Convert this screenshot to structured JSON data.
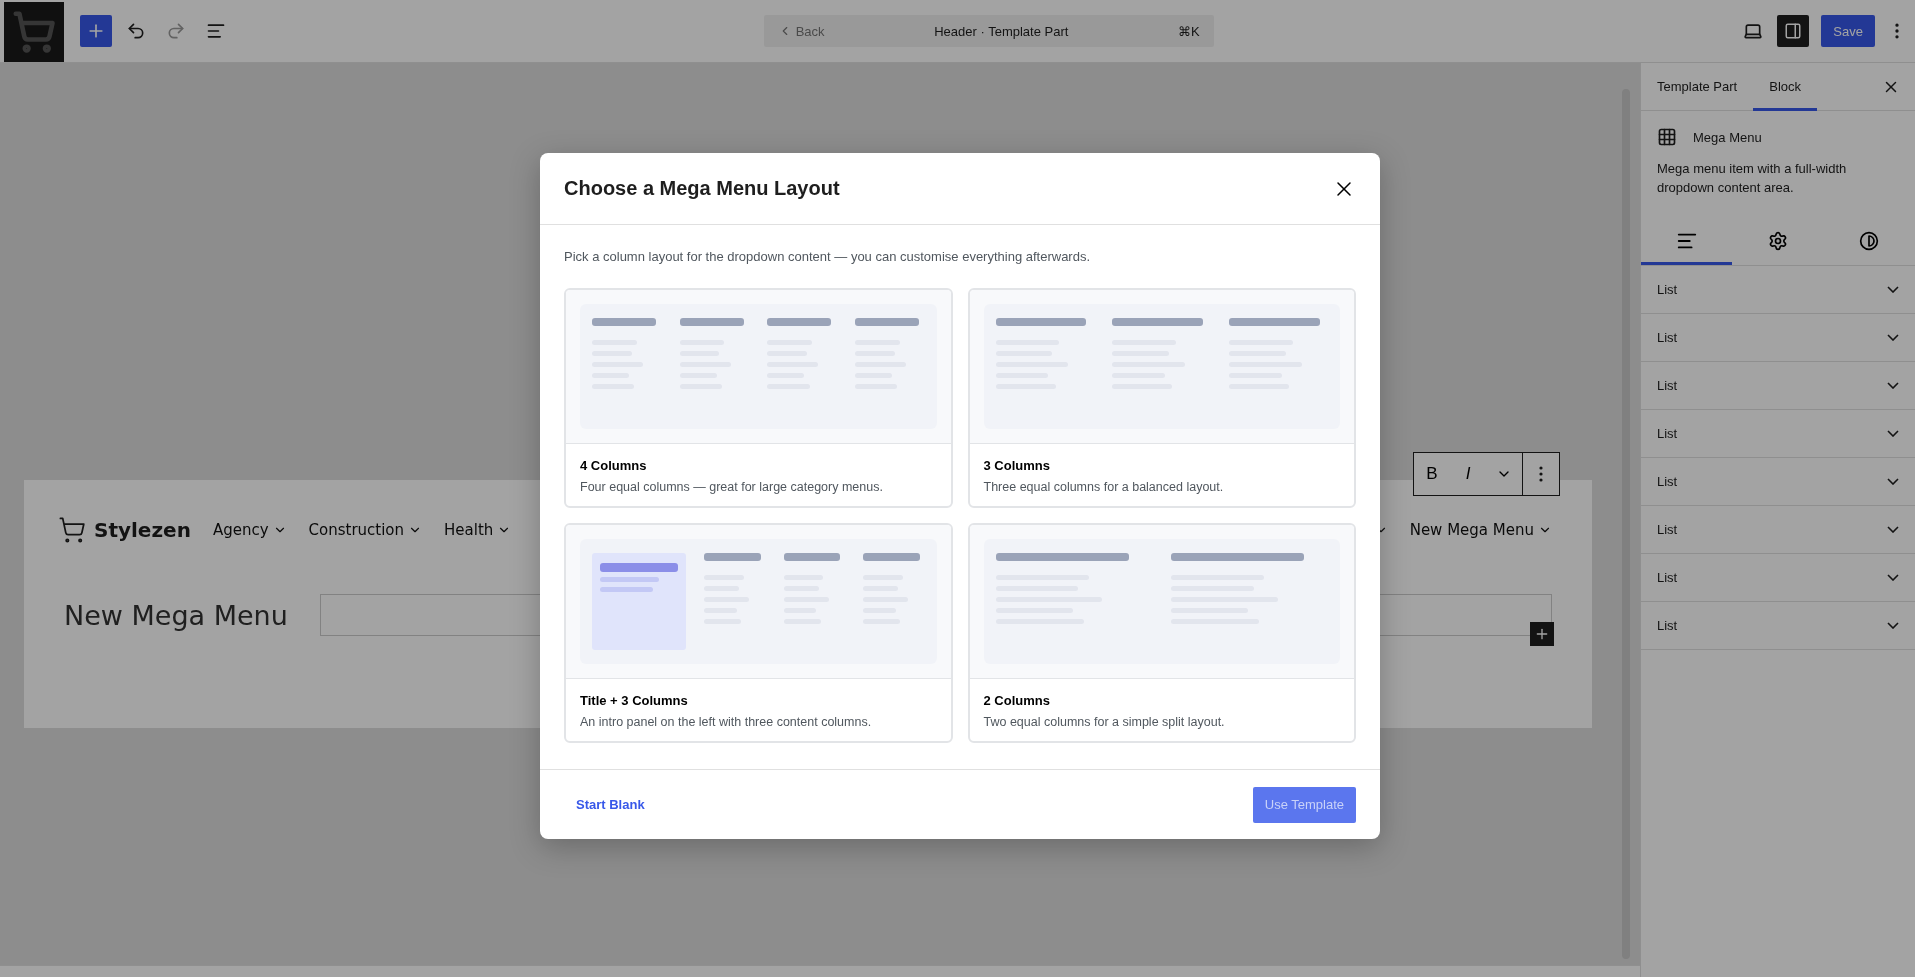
{
  "toolbar": {
    "back": "Back",
    "title": "Header · Template Part",
    "shortcut": "⌘K",
    "save": "Save"
  },
  "canvas": {
    "brand": "Stylezen",
    "nav_left": [
      {
        "label": "Agency"
      },
      {
        "label": "Construction"
      },
      {
        "label": "Health"
      }
    ],
    "nav_right": [
      {
        "label": "New Mega Menu"
      }
    ],
    "heading": "New Mega Menu",
    "format": {
      "bold": "B",
      "italic": "I"
    }
  },
  "sidebar": {
    "tabs": [
      {
        "label": "Template Part",
        "selected": false
      },
      {
        "label": "Block",
        "selected": true
      }
    ],
    "block": {
      "name": "Mega Menu",
      "description": "Mega menu item with a full-width dropdown content area."
    },
    "panel_tabs": [
      {
        "kind": "list",
        "selected": true
      },
      {
        "kind": "settings",
        "selected": false
      },
      {
        "kind": "styles",
        "selected": false
      }
    ],
    "sections": [
      {
        "label": "List",
        "expanded": false
      },
      {
        "label": "List",
        "expanded": false
      },
      {
        "label": "List",
        "expanded": false
      },
      {
        "label": "List",
        "expanded": false
      },
      {
        "label": "List",
        "expanded": false
      },
      {
        "label": "List",
        "expanded": false
      },
      {
        "label": "List",
        "expanded": false
      },
      {
        "label": "List",
        "expanded": false
      }
    ]
  },
  "dialog": {
    "title": "Choose a Mega Menu Layout",
    "intro": "Pick a column layout for the dropdown content — you can customise everything afterwards.",
    "layouts": [
      {
        "kind": "four",
        "title": "4 Columns",
        "description": "Four equal columns — great for large category menus."
      },
      {
        "kind": "three",
        "title": "3 Columns",
        "description": "Three equal columns for a balanced layout."
      },
      {
        "kind": "title-three",
        "title": "Title + 3 Columns",
        "description": "An intro panel on the left with three content columns."
      },
      {
        "kind": "two",
        "title": "2 Columns",
        "description": "Two equal columns for a simple split layout."
      }
    ],
    "secondary": "Start Blank",
    "primary": {
      "label": "Use Template",
      "disabled": true
    }
  }
}
